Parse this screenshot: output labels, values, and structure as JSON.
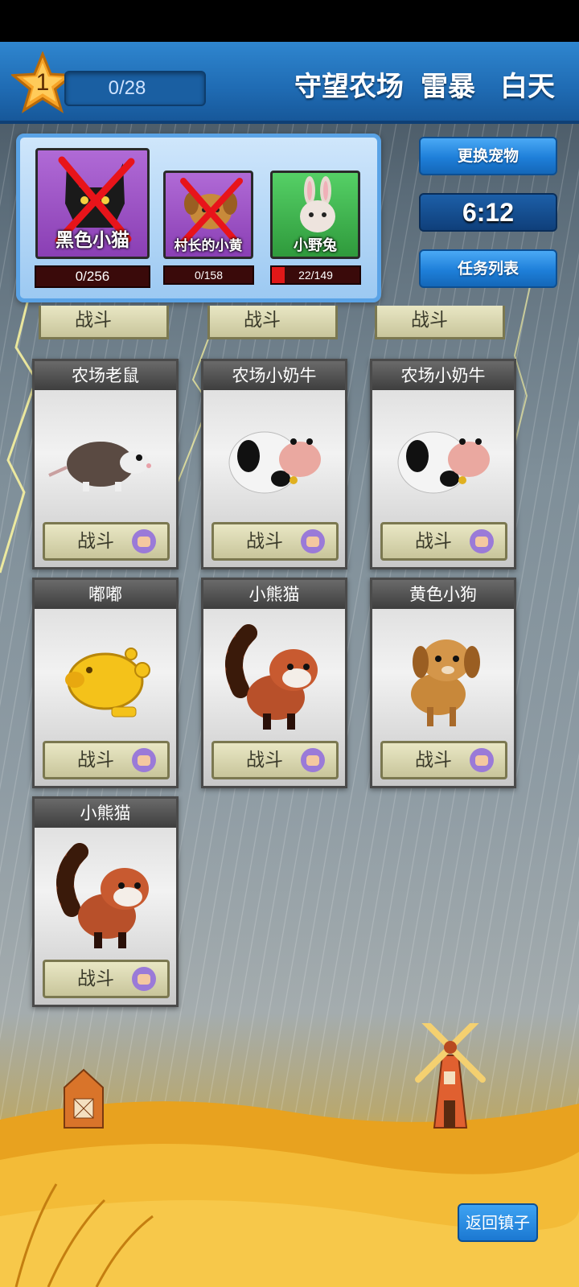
{
  "header": {
    "level": "1",
    "xp": "0/28",
    "farm_name": "守望农场",
    "weather": "雷暴",
    "time_of_day": "白天"
  },
  "my_pets": [
    {
      "name": "黑色小猫",
      "hp": "0/256",
      "hp_fraction": 0.0,
      "defeated": true,
      "color": "#9a4fc4"
    },
    {
      "name": "村长的小黄",
      "hp": "0/158",
      "hp_fraction": 0.0,
      "defeated": true,
      "color": "#9a4fc4"
    },
    {
      "name": "小野兔",
      "hp": "22/149",
      "hp_fraction": 0.15,
      "defeated": false,
      "color": "#3bb24a"
    }
  ],
  "side_buttons": {
    "change_pet": "更换宠物",
    "timer": "6:12",
    "task_list": "任务列表"
  },
  "enemies": [
    {
      "name": "农场老鼠",
      "icon": "opossum-icon",
      "fight_label": "战斗"
    },
    {
      "name": "农场小奶牛",
      "icon": "cow-icon",
      "fight_label": "战斗"
    },
    {
      "name": "农场小奶牛",
      "icon": "cow-icon",
      "fight_label": "战斗"
    },
    {
      "name": "嘟嘟",
      "icon": "gold-piggy-icon",
      "fight_label": "战斗"
    },
    {
      "name": "小熊猫",
      "icon": "red-panda-icon",
      "fight_label": "战斗"
    },
    {
      "name": "黄色小狗",
      "icon": "puppy-icon",
      "fight_label": "战斗"
    },
    {
      "name": "小熊猫",
      "icon": "red-panda-icon",
      "fight_label": "战斗"
    }
  ],
  "partial_row": {
    "fight_label": "战斗"
  },
  "footer": {
    "return_label": "返回镇子"
  },
  "colors": {
    "accent_blue": "#1e7fd9",
    "hp_red": "#e01818",
    "field_gold": "#f0b52a"
  }
}
